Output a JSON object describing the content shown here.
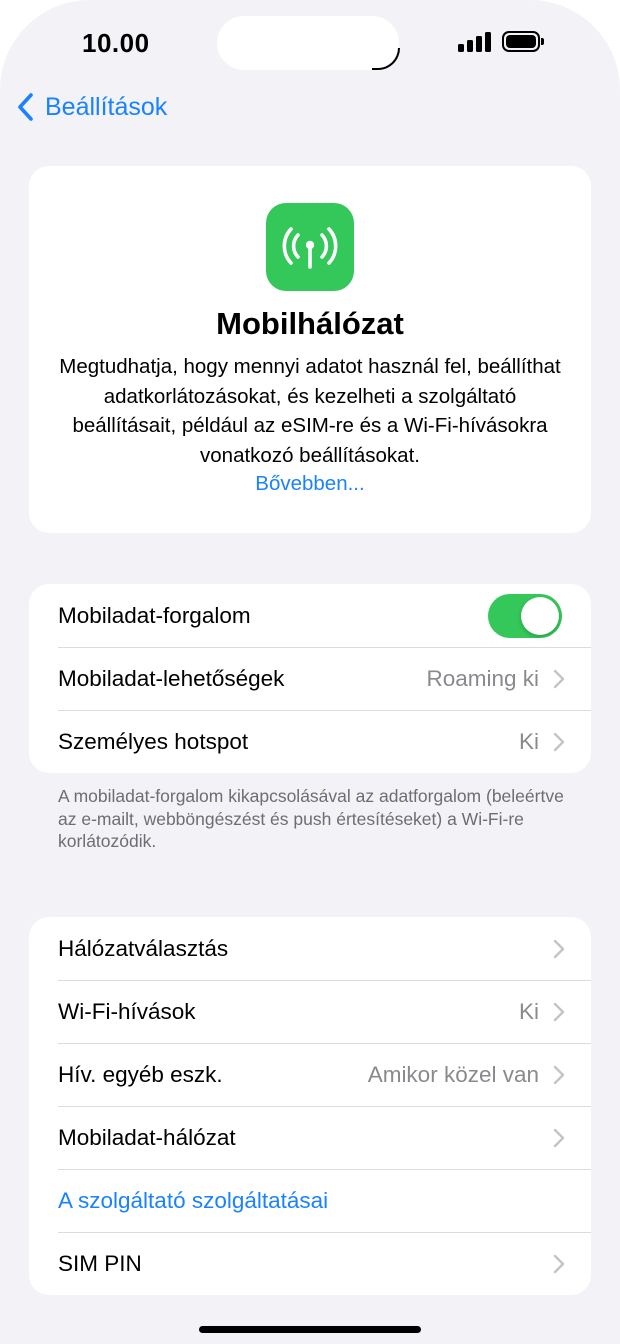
{
  "status_bar": {
    "time": "10.00"
  },
  "nav": {
    "back_label": "Beállítások"
  },
  "header": {
    "icon": "antenna-radiowaves-icon",
    "title": "Mobilhálózat",
    "description": "Megtudhatja, hogy mennyi adatot használ fel, beállíthat adatkorlátozásokat, és kezelheti a szolgáltató beállításait, például az eSIM-re és a Wi-Fi-hívásokra vonatkozó beállításokat.",
    "learn_more": "Bővebben..."
  },
  "group1": {
    "rows": [
      {
        "label": "Mobiladat-forgalom",
        "toggle_on": true
      },
      {
        "label": "Mobiladat-lehetőségek",
        "value": "Roaming ki"
      },
      {
        "label": "Személyes hotspot",
        "value": "Ki"
      }
    ],
    "footer": "A mobiladat-forgalom kikapcsolásával az adatforgalom (beleértve az e-mailt, webböngészést és push értesítéseket) a Wi-Fi-re korlátozódik."
  },
  "group2": {
    "rows": [
      {
        "label": "Hálózatválasztás",
        "value": ""
      },
      {
        "label": "Wi-Fi-hívások",
        "value": "Ki"
      },
      {
        "label": "Hív. egyéb eszk.",
        "value": "Amikor közel van"
      },
      {
        "label": "Mobiladat-hálózat",
        "value": ""
      },
      {
        "label": "A szolgáltató szolgáltatásai"
      },
      {
        "label": "SIM PIN",
        "value": ""
      }
    ]
  },
  "colors": {
    "accent": "#1a82ff",
    "green": "#34c759",
    "background": "#f2f2f7"
  }
}
